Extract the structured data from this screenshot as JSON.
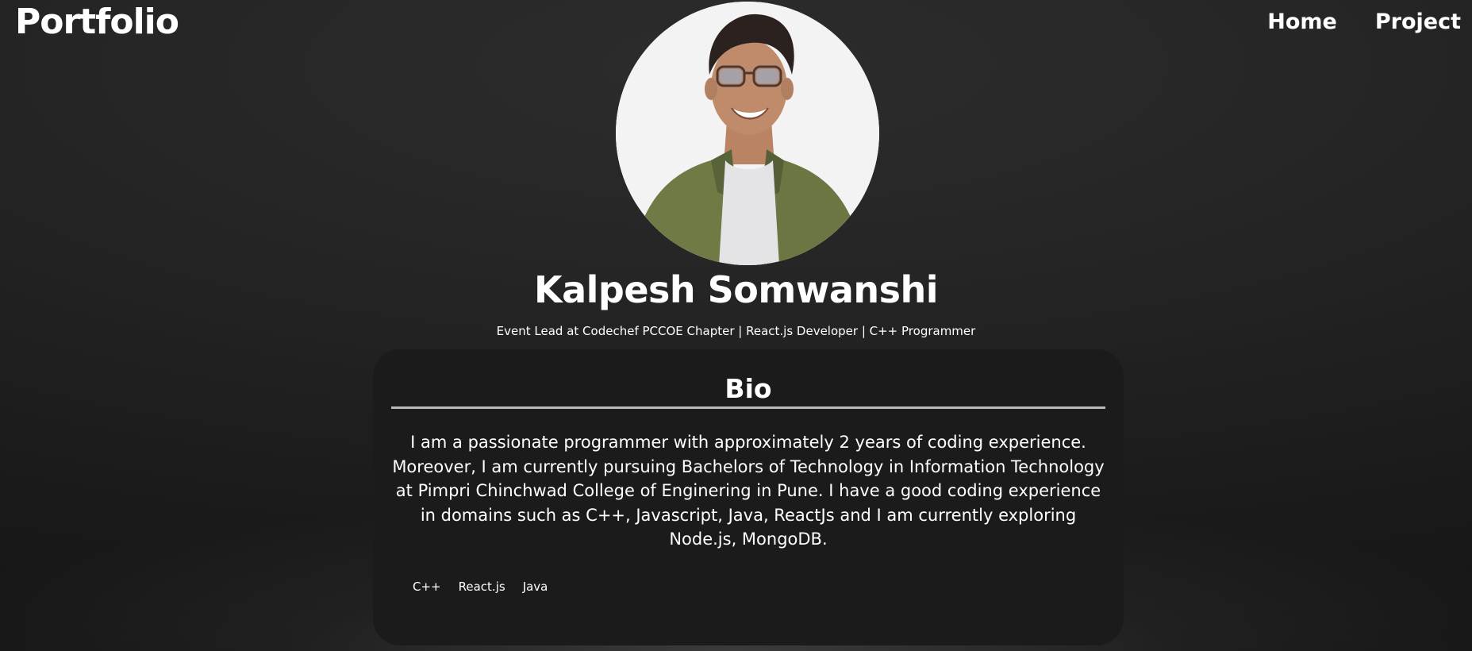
{
  "header": {
    "brand": "Portfolio",
    "nav": [
      {
        "label": "Home"
      },
      {
        "label": "Project"
      }
    ]
  },
  "profile": {
    "name": "Kalpesh Somwanshi",
    "tagline": "Event Lead at Codechef PCCOE Chapter | React.js Developer | C++ Programmer"
  },
  "bio": {
    "title": "Bio",
    "text": "I am a passionate programmer with approximately 2 years of coding experience. Moreover, I am currently pursuing Bachelors of Technology in Information Technology at Pimpri Chinchwad College of Enginering in Pune. I have a good coding experience in domains such as C++, Javascript, Java, ReactJs and I am currently exploring Node.js, MongoDB.",
    "skills": [
      "C++",
      "React.js",
      "Java"
    ]
  },
  "colors": {
    "background": "#222222",
    "card": "#1b1b1b",
    "text": "#ffffff",
    "divider": "#b9b9b9"
  }
}
